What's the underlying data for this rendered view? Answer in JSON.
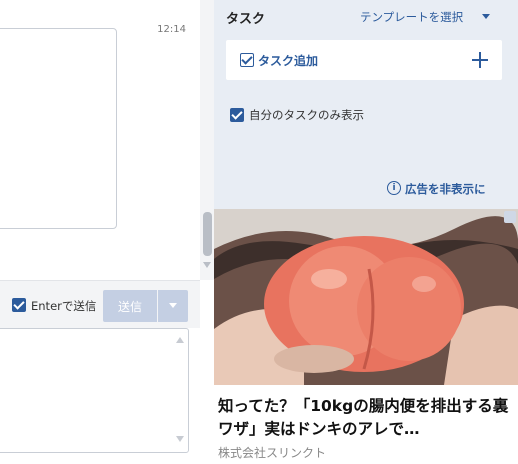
{
  "chat": {
    "timestamp": "12:14",
    "enter_to_send_label": "Enterで送信",
    "send_label": "送信"
  },
  "tasks": {
    "title": "タスク",
    "template_select": "テンプレートを選択",
    "add_task_label": "タスク追加",
    "my_tasks_only_label": "自分のタスクのみ表示"
  },
  "ad": {
    "hide_label": "広告を非表示に",
    "headline": "知ってた？「10kgの腸内便を排出する裏ワザ」実はドンキのアレで…",
    "sponsor": "株式会社スリンクト"
  },
  "colors": {
    "accent": "#2c5b9c",
    "task_pane_bg": "#e8edf4",
    "send_button_disabled": "#c4cfe3"
  },
  "icons": {
    "add_task": "checkbox-icon",
    "add": "plus-icon",
    "info": "info-icon",
    "template_caret": "caret-down-icon"
  }
}
